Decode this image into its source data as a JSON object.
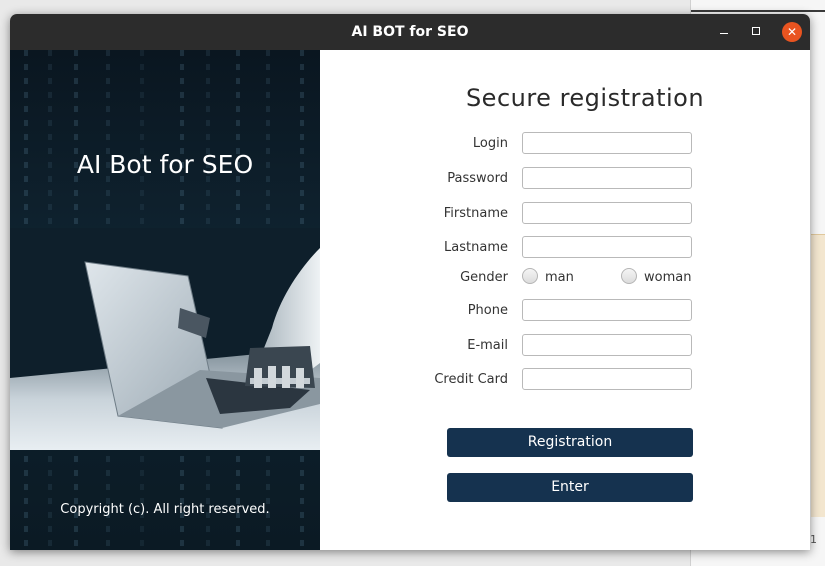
{
  "window": {
    "title": "AI BOT for SEO",
    "close_symbol": "✕"
  },
  "left": {
    "heading": "AI Bot for SEO",
    "copyright": "Copyright (c). All right reserved."
  },
  "form": {
    "title": "Secure registration",
    "fields": {
      "login": {
        "label": "Login",
        "value": ""
      },
      "password": {
        "label": "Password",
        "value": ""
      },
      "firstname": {
        "label": "Firstname",
        "value": ""
      },
      "lastname": {
        "label": "Lastname",
        "value": ""
      },
      "phone": {
        "label": "Phone",
        "value": ""
      },
      "email": {
        "label": "E-mail",
        "value": ""
      },
      "credit_card": {
        "label": "Credit Card",
        "value": ""
      }
    },
    "gender": {
      "label": "Gender",
      "options": [
        "man",
        "woman"
      ],
      "selected": ""
    },
    "buttons": {
      "registration": "Registration",
      "enter": "Enter"
    }
  },
  "colors": {
    "titlebar": "#2c2c2c",
    "close_button": "#e95420",
    "primary_button": "#15324f"
  },
  "icons": {
    "minimize": "minimize-icon",
    "maximize": "maximize-icon",
    "close": "close-icon"
  },
  "background_window": {
    "fragment_text": "1"
  }
}
